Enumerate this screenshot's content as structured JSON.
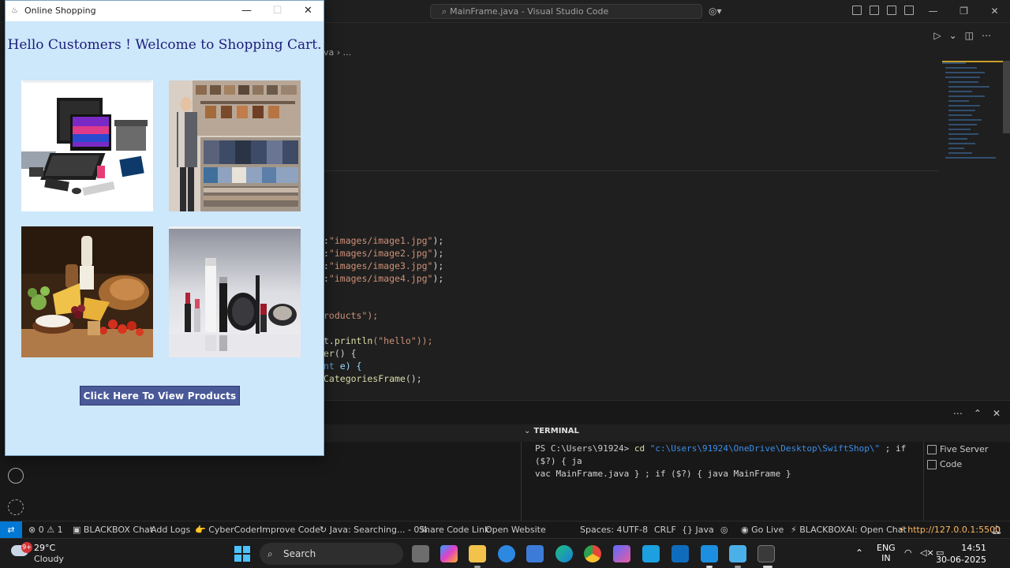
{
  "vscode": {
    "title": "MainFrame.java - Visual Studio Code",
    "breadcrumb": "va  ›  ...",
    "code_lines": [
      {
        "a": ":",
        "b": "\"images/image1.jpg\"",
        "c": ");"
      },
      {
        "a": ":",
        "b": "\"images/image2.jpg\"",
        "c": ");"
      },
      {
        "a": ":",
        "b": "\"images/image3.jpg\"",
        "c": ");"
      },
      {
        "a": ":",
        "b": "\"images/image4.jpg\"",
        "c": ");"
      }
    ],
    "code_products": "roducts\");",
    "code_println_a": "t.",
    "code_println_b": "println",
    "code_println_c": "(\"hello\"));",
    "code_er": "er",
    "code_er_b": "() {",
    "code_nt": "nt",
    "code_nt_b": " e) {",
    "code_cat": "CategoriesFrame",
    "code_cat_b": "();"
  },
  "panel": {
    "terminal_tab": "TERMINAL",
    "prompt": "PS C:\\Users\\91924>",
    "cmd_cd": "cd",
    "path": "\"c:\\Users\\91924\\OneDrive\\Desktop\\SwiftShop\\\"",
    "rest1": " ; if ($?) { ja",
    "rest2": "vac MainFrame.java } ; if ($?) { java MainFrame }",
    "terminals": [
      "Five Server",
      "Code"
    ]
  },
  "statusbar": {
    "problems": "⊗ 0 ⚠ 1",
    "blackbox_chat": "BLACKBOX Chat",
    "add_logs": "Add Logs",
    "cybercoder": "CyberCoder",
    "improve_code": "Improve Code",
    "java_status": "Java: Searching... - 0%",
    "share_code_link": "Share Code Link",
    "open_website": "Open Website",
    "spaces": "Spaces: 4",
    "encoding": "UTF-8",
    "eol": "CRLF",
    "language": "{} Java",
    "go_live": "Go Live",
    "blackbox_ai": "BLACKBOXAI: Open Chat",
    "server_url": "http://127.0.0.1:5500"
  },
  "taskbar": {
    "temperature": "29°C",
    "condition": "Cloudy",
    "weather_badge": "9+",
    "search_placeholder": "Search",
    "lang1": "ENG",
    "lang2": "IN",
    "time": "14:51",
    "date": "30-06-2025"
  },
  "swing_window": {
    "title": "Online Shopping",
    "welcome": "Hello Customers ! Welcome to Shopping Cart.",
    "button_label": "Click Here To View Products",
    "images": [
      "electronics",
      "clothing store",
      "groceries",
      "cosmetics"
    ]
  },
  "colors": {
    "swing_bg": "#cde7fb",
    "button_bg": "#4a5a99",
    "welcome_text": "#1c1c7a",
    "vscode_accent": "#0078d4"
  }
}
